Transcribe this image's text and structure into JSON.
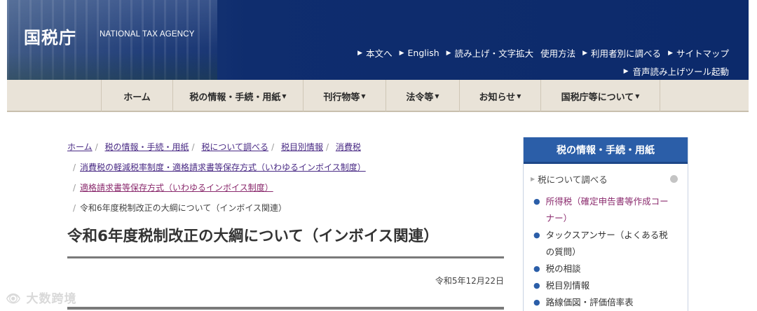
{
  "header": {
    "logo": "国税庁",
    "logo_sub": "NATIONAL TAX AGENCY",
    "utility": [
      {
        "label": "本文へ",
        "arrow": true
      },
      {
        "label": "English",
        "arrow": true
      },
      {
        "label": "読み上げ・文字拡大",
        "arrow": true
      },
      {
        "label": "使用方法",
        "arrow": false
      },
      {
        "label": "利用者別に調べる",
        "arrow": true
      },
      {
        "label": "サイトマップ",
        "arrow": true
      }
    ],
    "voice": "音声読み上げツール起動"
  },
  "nav": [
    {
      "label": "ホーム",
      "dropdown": false
    },
    {
      "label": "税の情報・手続・用紙",
      "dropdown": true
    },
    {
      "label": "刊行物等",
      "dropdown": true
    },
    {
      "label": "法令等",
      "dropdown": true
    },
    {
      "label": "お知らせ",
      "dropdown": true
    },
    {
      "label": "国税庁等について",
      "dropdown": true
    }
  ],
  "breadcrumb": [
    "ホーム",
    "税の情報・手続・用紙",
    "税について調べる",
    "税目別情報",
    "消費税",
    "消費税の軽減税率制度・適格請求書等保存方式（いわゆるインボイス制度）",
    "適格請求書等保存方式（いわゆるインボイス制度）",
    "令和6年度税制改正の大綱について（インボイス関連）"
  ],
  "page_title": "令和6年度税制改正の大綱について（インボイス関連）",
  "date": "令和5年12月22日",
  "sidebar": {
    "title": "税の情報・手続・用紙",
    "sub": "税について調べる",
    "items": [
      {
        "label": "所得税（確定申告書等作成コーナー）",
        "visited": true
      },
      {
        "label": "タックスアンサー（よくある税の質問）",
        "visited": false
      },
      {
        "label": "税の相談",
        "visited": false
      },
      {
        "label": "税目別情報",
        "visited": false
      },
      {
        "label": "路線価図・評価倍率表",
        "visited": false
      }
    ]
  },
  "watermark": "大数跨境",
  "colors": {
    "header_bg": "#0c2a6b",
    "nav_bg": "#e9e3d8",
    "sidebar_head": "#2b5ea8",
    "link": "#4a2b85"
  }
}
